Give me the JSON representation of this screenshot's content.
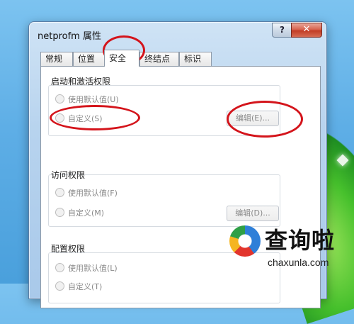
{
  "window": {
    "title": "netprofm 属性",
    "help_label": "?",
    "close_label": "✕"
  },
  "tabs": [
    {
      "label": "常规"
    },
    {
      "label": "位置"
    },
    {
      "label": "安全",
      "active": true
    },
    {
      "label": "终结点"
    },
    {
      "label": "标识"
    }
  ],
  "groups": {
    "launch": {
      "title": "启动和激活权限",
      "option_default": "使用默认值(U)",
      "option_custom": "自定义(S)",
      "edit_button": "编辑(E)..."
    },
    "access": {
      "title": "访问权限",
      "option_default": "使用默认值(F)",
      "option_custom": "自定义(M)",
      "edit_button": "编辑(D)..."
    },
    "config": {
      "title": "配置权限",
      "option_default": "使用默认值(L)",
      "option_custom": "自定义(T)"
    }
  },
  "watermark": {
    "brand": "查询啦",
    "domain": "chaxunla.com"
  },
  "colors": {
    "annotation": "#d4141b",
    "desktop": "#5eaee6"
  }
}
